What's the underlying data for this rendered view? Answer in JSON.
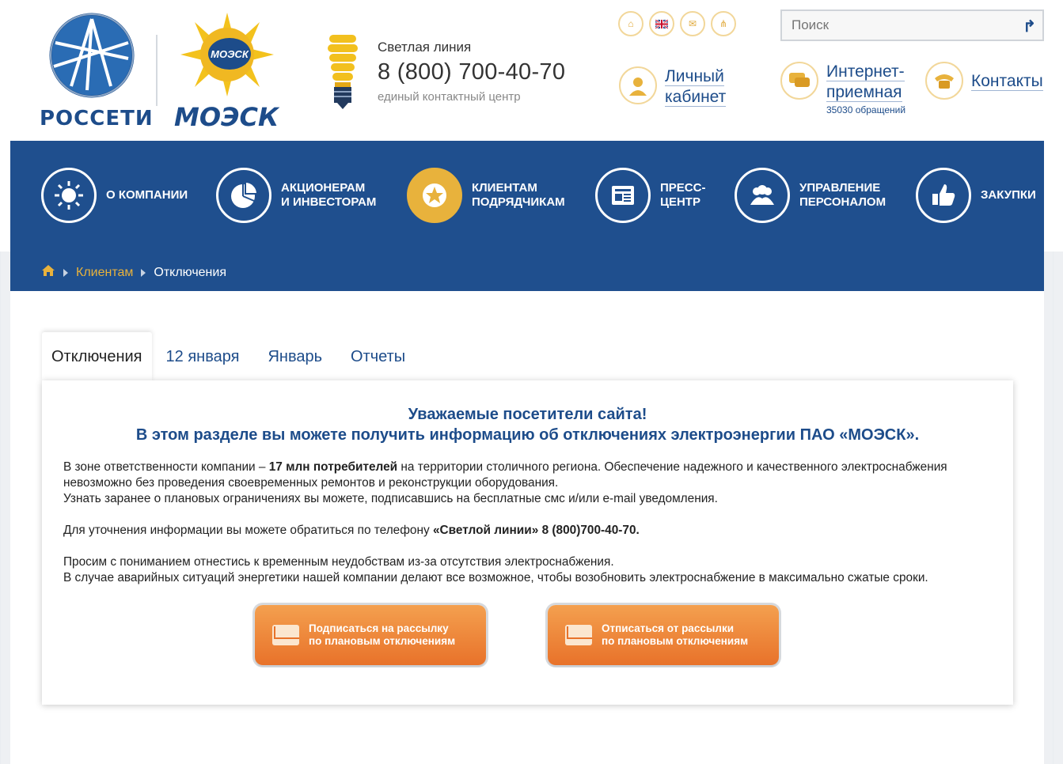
{
  "header": {
    "logo_rosseti": "РОССЕТИ",
    "logo_moesk": "МОЭСК",
    "logo_moesk_badge": "МОЭСК",
    "hotline": {
      "label": "Светлая линия",
      "phone": "8 (800) 700-40-70",
      "sub": "единый контактный центр"
    },
    "util_icons": [
      "home-icon",
      "uk-flag-icon",
      "mail-icon",
      "sitemap-icon"
    ],
    "search": {
      "placeholder": "Поиск",
      "go_icon": "search-go-icon"
    },
    "links": {
      "cabinet": {
        "line1": "Личный",
        "line2": "кабинет",
        "icon": "user-icon"
      },
      "reception": {
        "line1": "Интернет-",
        "line2": "приемная",
        "count": "35030 обращений",
        "icon": "chat-icon"
      },
      "contacts": {
        "label": "Контакты",
        "icon": "phone-icon"
      }
    }
  },
  "nav": {
    "items": [
      {
        "line1": "О компании",
        "line2": "",
        "icon": "sun-icon"
      },
      {
        "line1": "Акционерам",
        "line2": "и инвесторам",
        "icon": "pie-chart-icon"
      },
      {
        "line1": "Клиентам",
        "line2": "подрядчикам",
        "icon": "star-icon"
      },
      {
        "line1": "Пресс-",
        "line2": "центр",
        "icon": "newspaper-icon"
      },
      {
        "line1": "Управление",
        "line2": "персоналом",
        "icon": "people-icon"
      },
      {
        "line1": "Закупки",
        "line2": "",
        "icon": "thumbs-up-icon"
      }
    ]
  },
  "breadcrumb": {
    "home_icon": "home-icon",
    "link": "Клиентам",
    "current": "Отключения"
  },
  "tabs": [
    "Отключения",
    "12 января",
    "Январь",
    "Отчеты"
  ],
  "content": {
    "heading1": "Уважаемые посетители сайта!",
    "heading2": "В этом разделе вы можете получить информацию об отключениях электроэнергии ПАО «МОЭСК».",
    "p1_a": "В зоне ответственности компании – ",
    "p1_b": "17 млн потребителей",
    "p1_c": " на территории столичного региона. Обеспечение надежного и качественного электроснабжения невозможно без проведения своевременных ремонтов и реконструкции оборудования.",
    "p1_d": "Узнать заранее о плановых ограничениях вы можете, подписавшись на бесплатные смс и/или e-mail уведомления.",
    "p2_a": "Для уточнения информации вы можете обратиться по телефону ",
    "p2_b": "«Светлой линии»",
    "p2_c": " 8 (800)700-40-70.",
    "p3_a": "Просим с пониманием отнестись к временным неудобствам из-за отсутствия электроснабжения.",
    "p3_b": "В случае аварийных ситуаций энергетики нашей компании делают все возможное, чтобы возобновить электроснабжение в максимально сжатые сроки.",
    "subscribe": {
      "line1": "Подписаться на рассылку",
      "line2": "по плановым отключениям"
    },
    "unsubscribe": {
      "line1": "Отписаться от рассылки",
      "line2": "по плановым отключениям"
    }
  },
  "colors": {
    "brand_blue": "#1f4f8e",
    "accent_gold": "#e8b23c",
    "button_orange": "#e8722a"
  }
}
